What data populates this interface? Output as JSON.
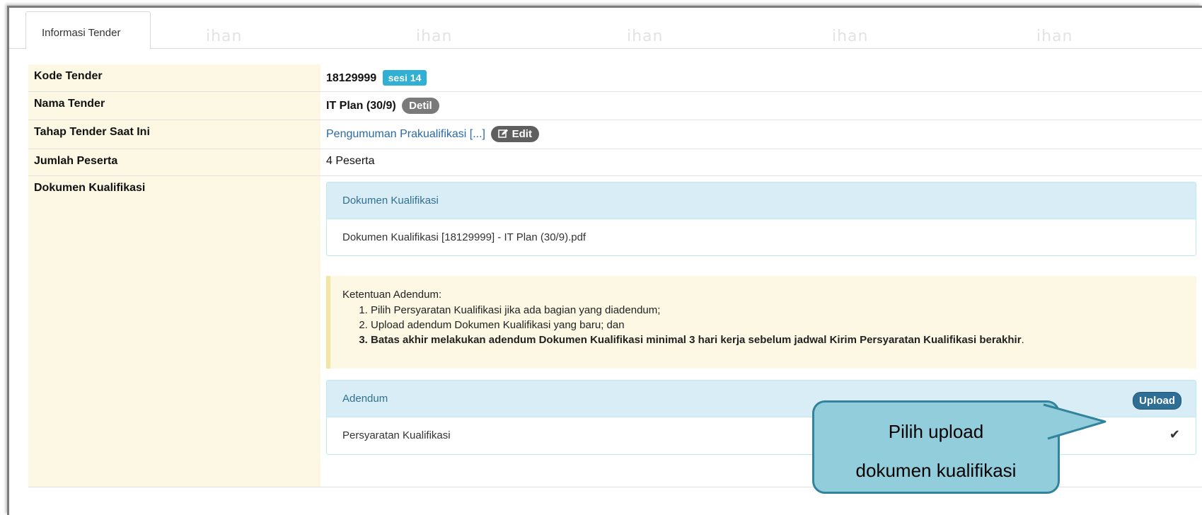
{
  "tab": {
    "label": "Informasi Tender"
  },
  "watermark": [
    "ihan",
    "ihan",
    "ihan",
    "ihan",
    "ihan"
  ],
  "rows": {
    "kode": {
      "label": "Kode Tender",
      "value": "18129999",
      "badge": "sesi 14"
    },
    "nama": {
      "label": "Nama Tender",
      "value": "IT Plan (30/9)",
      "badge": "Detil"
    },
    "tahap": {
      "label": "Tahap Tender Saat Ini",
      "value": "Pengumuman Prakualifikasi [...]",
      "badge": "Edit"
    },
    "jumlah": {
      "label": "Jumlah Peserta",
      "value": "4 Peserta"
    },
    "dokumen": {
      "label": "Dokumen Kualifikasi"
    }
  },
  "dokumen_panel": {
    "heading": "Dokumen Kualifikasi",
    "file": "Dokumen Kualifikasi [18129999] - IT Plan (30/9).pdf"
  },
  "ketentuan": {
    "title": "Ketentuan Adendum:",
    "items": [
      "Pilih Persyaratan Kualifikasi jika ada bagian yang diadendum;",
      "Upload adendum Dokumen Kualifikasi yang baru; dan",
      "Batas akhir melakukan adendum Dokumen Kualifikasi minimal 3 hari kerja sebelum jadwal Kirim Persyaratan Kualifikasi berakhir"
    ],
    "end_period": "."
  },
  "adendum_panel": {
    "heading": "Adendum",
    "upload_label": "Upload",
    "item": "Persyaratan Kualifikasi",
    "check_icon": "✔"
  },
  "callout": {
    "line1": "Pilih upload",
    "line2": "dokumen kualifikasi"
  },
  "colors": {
    "label_bg": "#fcf8e3",
    "panel_head_bg": "#d9edf7",
    "badge_blue": "#31b0d5",
    "upload_btn": "#2f6f95",
    "callout_bg": "#92cddc",
    "callout_border": "#31849b"
  }
}
